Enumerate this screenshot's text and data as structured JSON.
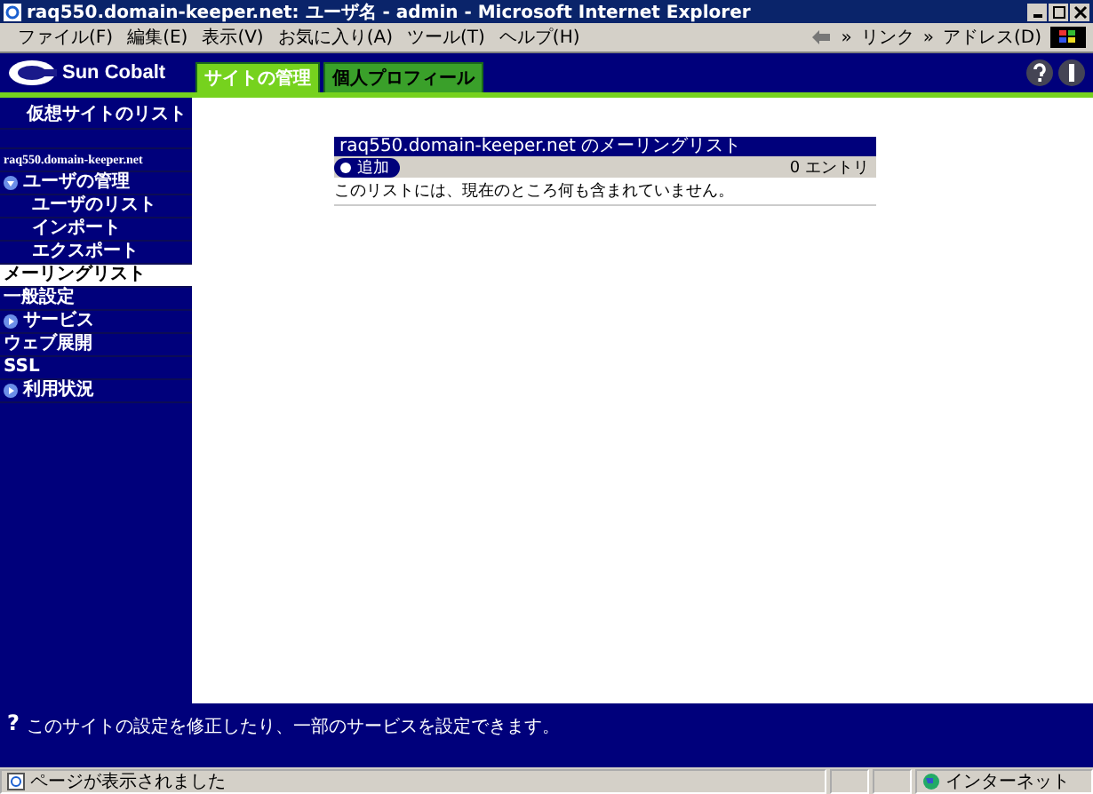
{
  "window": {
    "title": "raq550.domain-keeper.net: ユーザ名 - admin - Microsoft Internet Explorer"
  },
  "menu": [
    "ファイル(F)",
    "編集(E)",
    "表示(V)",
    "お気に入り(A)",
    "ツール(T)",
    "ヘルプ(H)"
  ],
  "toolbar": {
    "more": "»",
    "links": "リンク",
    "links_more": "»",
    "address": "アドレス(D)"
  },
  "brand": "Sun Cobalt",
  "tabs": [
    {
      "label": "サイトの管理",
      "selected": true
    },
    {
      "label": "個人プロフィール",
      "selected": false
    }
  ],
  "sidebar": {
    "top": "仮想サイトのリスト",
    "site": "raq550.domain-keeper.net",
    "items": [
      {
        "label": "ユーザの管理",
        "expandable": true,
        "expanded": true,
        "selected": false,
        "children": [
          {
            "label": "ユーザのリスト",
            "selected": false
          },
          {
            "label": "インポート",
            "selected": false
          },
          {
            "label": "エクスポート",
            "selected": false
          }
        ]
      },
      {
        "label": "メーリングリスト",
        "expandable": false,
        "selected": true
      },
      {
        "label": "一般設定",
        "expandable": false,
        "selected": false
      },
      {
        "label": "サービス",
        "expandable": true,
        "expanded": false,
        "selected": false
      },
      {
        "label": "ウェブ展開",
        "expandable": false,
        "selected": false
      },
      {
        "label": "SSL",
        "expandable": false,
        "selected": false
      },
      {
        "label": "利用状況",
        "expandable": true,
        "expanded": false,
        "selected": false
      }
    ]
  },
  "panel": {
    "title": "raq550.domain-keeper.net のメーリングリスト",
    "add_button": "追加",
    "count": "0 エントリ",
    "message": "このリストには、現在のところ何も含まれていません。"
  },
  "help_bar": {
    "icon": "?",
    "text": "このサイトの設定を修正したり、一部のサービスを設定できます。"
  },
  "status_bar": {
    "text": "ページが表示されました",
    "zone": "インターネット"
  }
}
